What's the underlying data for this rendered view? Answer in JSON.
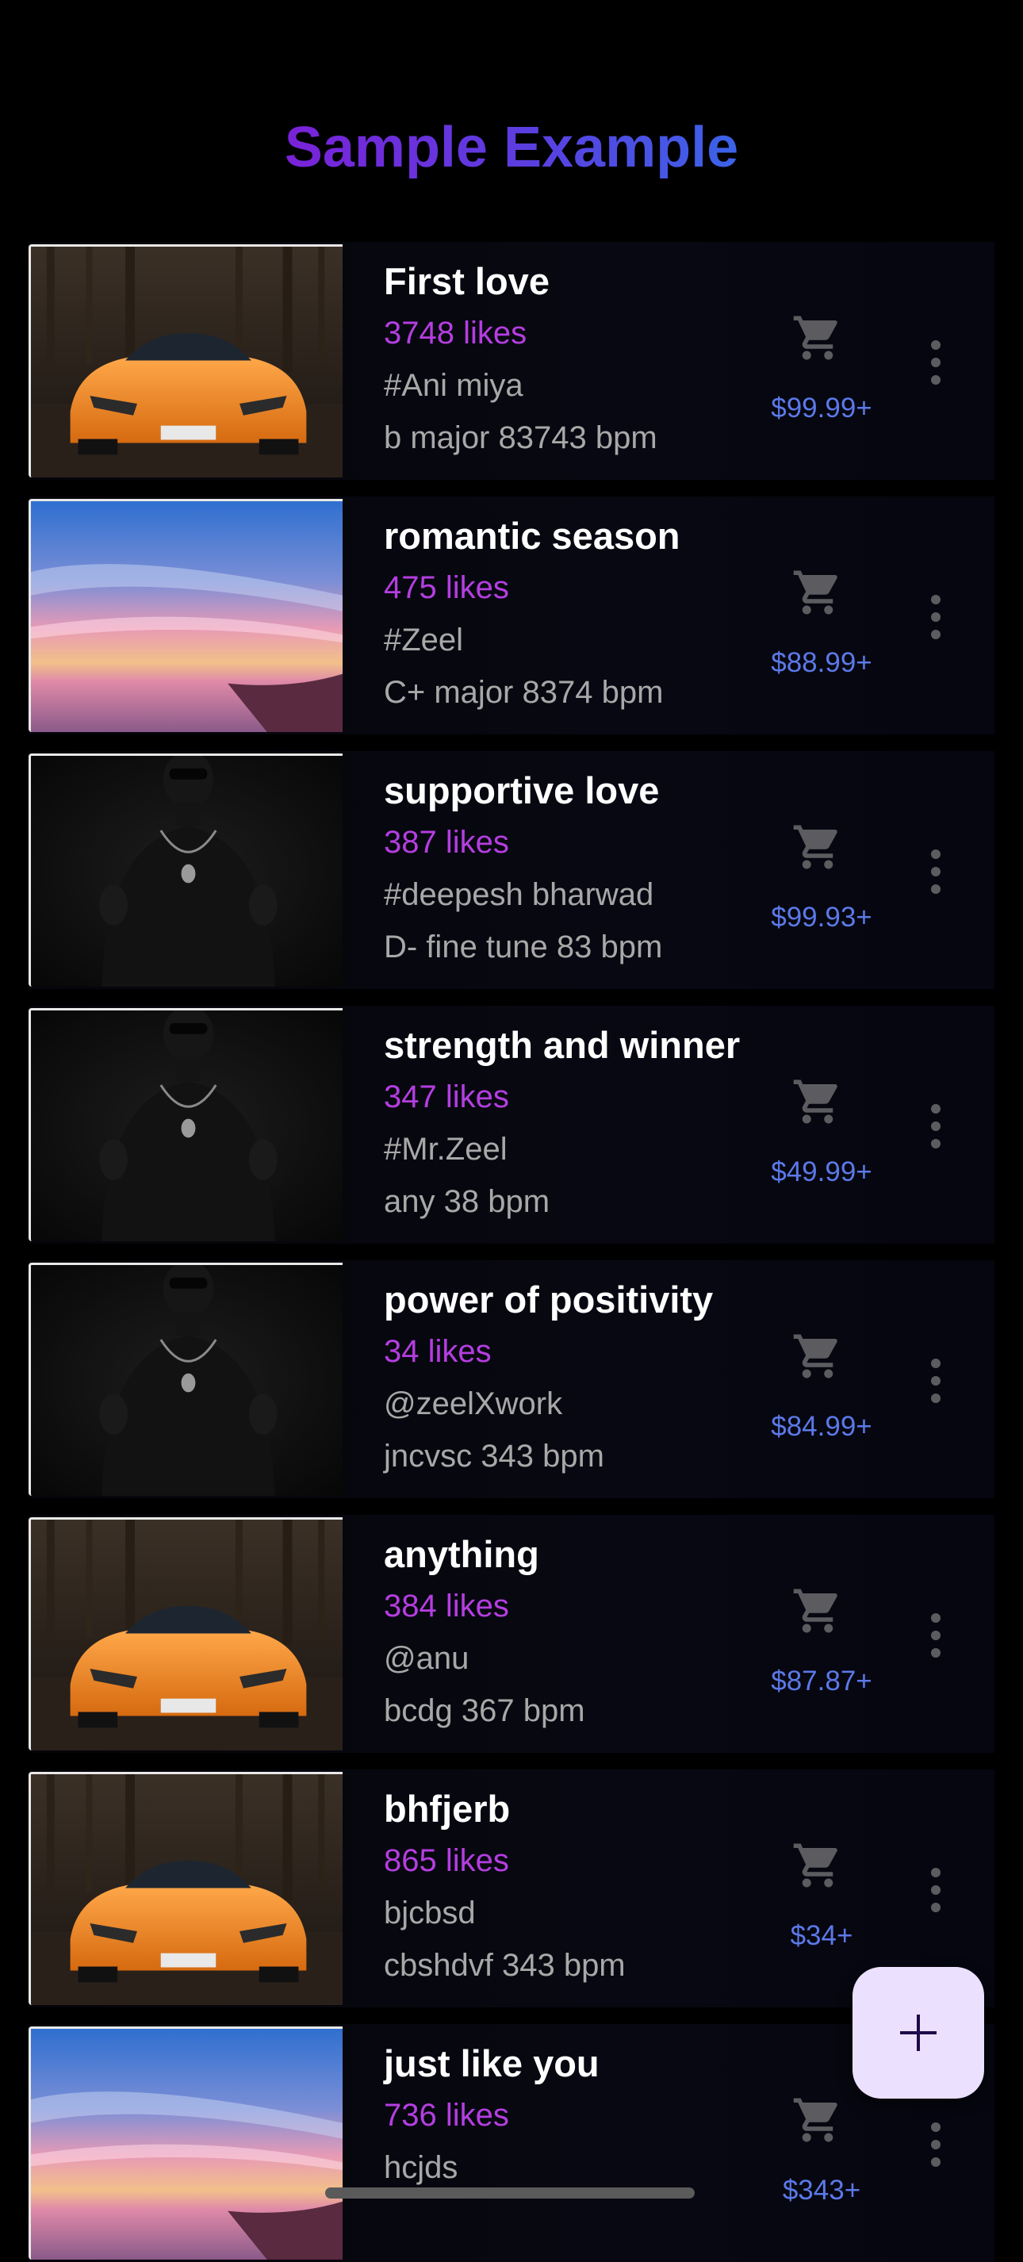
{
  "header": {
    "title": "Sample Example"
  },
  "tracks": [
    {
      "title": "First love",
      "likes": "3748 likes",
      "tag": "#Ani miya",
      "meta": "b major 83743 bpm",
      "price": "$99.99+",
      "image": "car"
    },
    {
      "title": "romantic season",
      "likes": "475 likes",
      "tag": "#Zeel",
      "meta": "C+ major 8374 bpm",
      "price": "$88.99+",
      "image": "sunset"
    },
    {
      "title": "supportive love",
      "likes": "387 likes",
      "tag": " #deepesh bharwad",
      "meta": "D- fine tune  83 bpm",
      "price": "$99.93+",
      "image": "portrait"
    },
    {
      "title": "strength and winner",
      "likes": "347 likes",
      "tag": " #Mr.Zeel",
      "meta": "any 38 bpm",
      "price": "$49.99+",
      "image": "portrait"
    },
    {
      "title": "power of positivity",
      "likes": "34 likes",
      "tag": "@zeelXwork",
      "meta": "jncvsc 343 bpm",
      "price": "$84.99+",
      "image": "portrait"
    },
    {
      "title": "anything",
      "likes": "384 likes",
      "tag": "@anu",
      "meta": "bcdg 367 bpm",
      "price": "$87.87+",
      "image": "car"
    },
    {
      "title": "bhfjerb",
      "likes": "865 likes",
      "tag": "bjcbsd",
      "meta": "cbshdvf 343 bpm",
      "price": "$34+",
      "image": "car"
    },
    {
      "title": "just like you",
      "likes": "736 likes",
      "tag": "hcjds",
      "meta": "",
      "price": "$343+",
      "image": "sunset"
    }
  ],
  "icons": {
    "cart": "cart-icon",
    "more": "more-vertical-icon",
    "add": "plus-icon"
  },
  "colors": {
    "title_start": "#7a22d8",
    "title_end": "#3b63e8",
    "likes": "#b43ee0",
    "price": "#5b79e8",
    "fab": "#ece0ff"
  }
}
